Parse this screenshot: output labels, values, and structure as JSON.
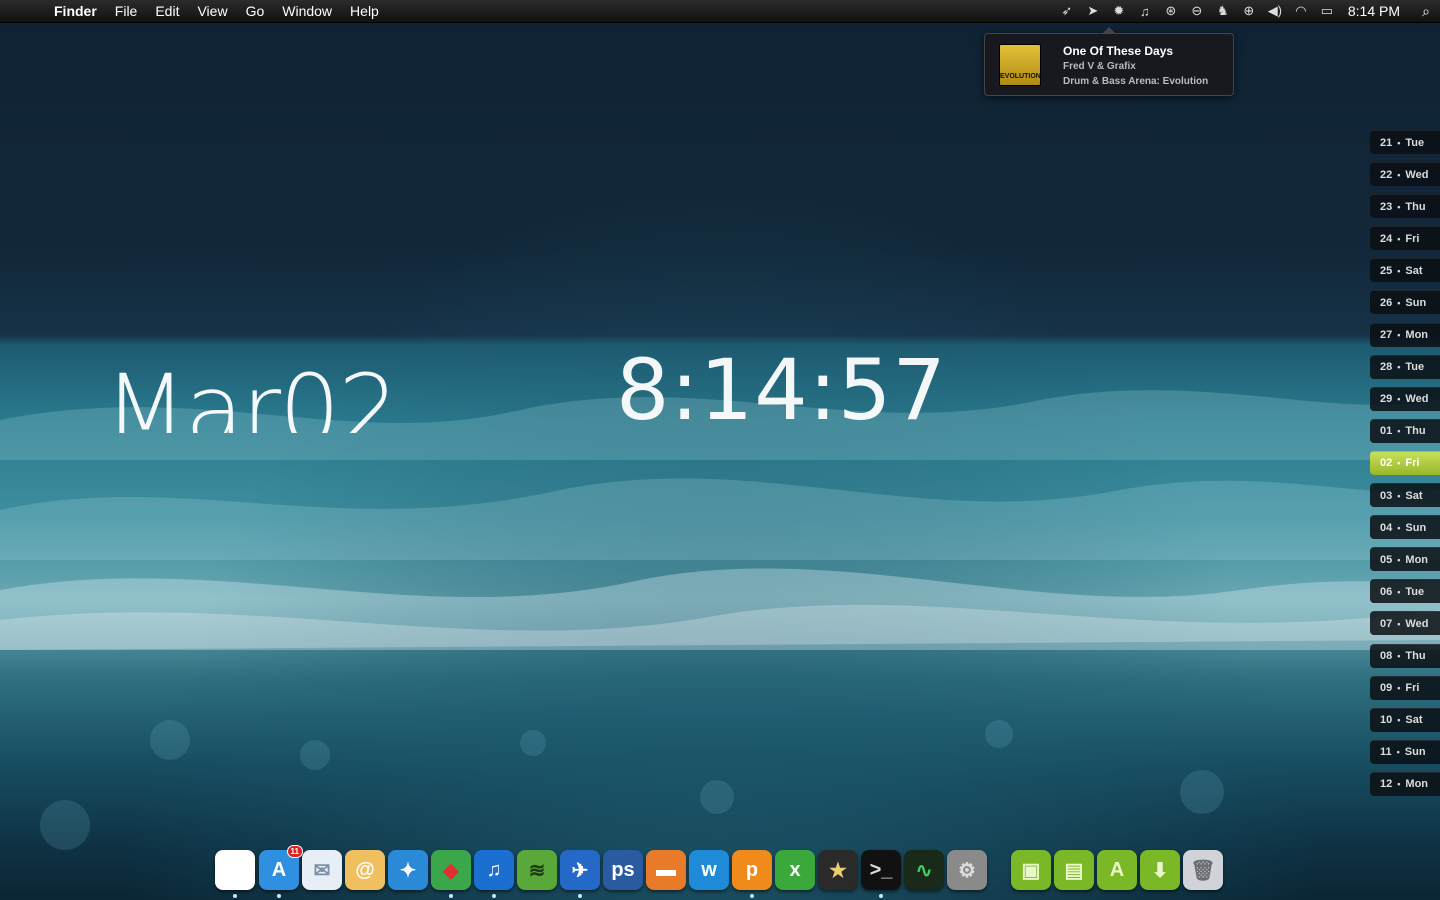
{
  "menubar": {
    "apple_glyph": "",
    "items": [
      "Finder",
      "File",
      "Edit",
      "View",
      "Go",
      "Window",
      "Help"
    ],
    "status_icons": [
      "bird-icon",
      "cursor-icon",
      "gear-icon",
      "music-note-icon",
      "timer-icon",
      "drive-icon",
      "evernote-icon",
      "settings-circle-icon",
      "volume-icon",
      "wifi-icon",
      "battery-icon"
    ],
    "clock": "8:14 PM",
    "spotlight_glyph": "⌕"
  },
  "notification": {
    "song": "One Of These Days",
    "artist": "Fred V & Grafix",
    "album": "Drum & Bass Arena: Evolution",
    "art_text": "EVOLUTION"
  },
  "widgets": {
    "date": "Mar02",
    "time": "8:14:57"
  },
  "calendar": [
    {
      "day": "21",
      "weekday": "Tue",
      "today": false
    },
    {
      "day": "22",
      "weekday": "Wed",
      "today": false
    },
    {
      "day": "23",
      "weekday": "Thu",
      "today": false
    },
    {
      "day": "24",
      "weekday": "Fri",
      "today": false
    },
    {
      "day": "25",
      "weekday": "Sat",
      "today": false
    },
    {
      "day": "26",
      "weekday": "Sun",
      "today": false
    },
    {
      "day": "27",
      "weekday": "Mon",
      "today": false
    },
    {
      "day": "28",
      "weekday": "Tue",
      "today": false
    },
    {
      "day": "29",
      "weekday": "Wed",
      "today": false
    },
    {
      "day": "01",
      "weekday": "Thu",
      "today": false
    },
    {
      "day": "02",
      "weekday": "Fri",
      "today": true
    },
    {
      "day": "03",
      "weekday": "Sat",
      "today": false
    },
    {
      "day": "04",
      "weekday": "Sun",
      "today": false
    },
    {
      "day": "05",
      "weekday": "Mon",
      "today": false
    },
    {
      "day": "06",
      "weekday": "Tue",
      "today": false
    },
    {
      "day": "07",
      "weekday": "Wed",
      "today": false
    },
    {
      "day": "08",
      "weekday": "Thu",
      "today": false
    },
    {
      "day": "09",
      "weekday": "Fri",
      "today": false
    },
    {
      "day": "10",
      "weekday": "Sat",
      "today": false
    },
    {
      "day": "11",
      "weekday": "Sun",
      "today": false
    },
    {
      "day": "12",
      "weekday": "Mon",
      "today": false
    }
  ],
  "dock": [
    {
      "name": "finder-apple-icon",
      "glyph": "",
      "bg": "#ffffff",
      "fg": "#111111",
      "running": true
    },
    {
      "name": "app-store-icon",
      "glyph": "A",
      "bg": "#2f8fe0",
      "fg": "#ffffff",
      "running": true,
      "badge": "11"
    },
    {
      "name": "mail-icon",
      "glyph": "✉",
      "bg": "#e8eef5",
      "fg": "#7a8ea8",
      "running": false
    },
    {
      "name": "address-book-icon",
      "glyph": "@",
      "bg": "#f0c060",
      "fg": "#ffffff",
      "running": false
    },
    {
      "name": "safari-icon",
      "glyph": "✦",
      "bg": "#2a8ad8",
      "fg": "#ffffff",
      "running": false
    },
    {
      "name": "maps-icon",
      "glyph": "◆",
      "bg": "#3aa84a",
      "fg": "#e03030",
      "running": true
    },
    {
      "name": "itunes-icon",
      "glyph": "♫",
      "bg": "#1a6fd0",
      "fg": "#ffffff",
      "running": true
    },
    {
      "name": "spotify-icon",
      "glyph": "≋",
      "bg": "#5aa83a",
      "fg": "#1a3a10",
      "running": false
    },
    {
      "name": "adium-icon",
      "glyph": "✈",
      "bg": "#2468c8",
      "fg": "#ffffff",
      "running": true
    },
    {
      "name": "photoshop-icon",
      "glyph": "ps",
      "bg": "#2a5aa0",
      "fg": "#ffffff",
      "running": false
    },
    {
      "name": "sparrow-icon",
      "glyph": "▬",
      "bg": "#e87a2a",
      "fg": "#ffffff",
      "running": false
    },
    {
      "name": "word-icon",
      "glyph": "w",
      "bg": "#1e8ad8",
      "fg": "#ffffff",
      "running": false
    },
    {
      "name": "pages-icon",
      "glyph": "p",
      "bg": "#f08a1a",
      "fg": "#ffffff",
      "running": true
    },
    {
      "name": "excel-icon",
      "glyph": "x",
      "bg": "#3aa83a",
      "fg": "#ffffff",
      "running": false
    },
    {
      "name": "imovie-icon",
      "glyph": "★",
      "bg": "#2a2a2a",
      "fg": "#e8d070",
      "running": false
    },
    {
      "name": "terminal-icon",
      "glyph": ">_",
      "bg": "#111111",
      "fg": "#dddddd",
      "running": true
    },
    {
      "name": "activity-monitor-icon",
      "glyph": "∿",
      "bg": "#1a2a1a",
      "fg": "#40d060",
      "running": false
    },
    {
      "name": "system-preferences-icon",
      "glyph": "⚙",
      "bg": "#8a8a8a",
      "fg": "#dddddd",
      "running": false
    },
    {
      "name": "folder-apps-icon",
      "glyph": "▣",
      "bg": "#7ab828",
      "fg": "#eaf7c8",
      "running": false
    },
    {
      "name": "folder-documents-icon",
      "glyph": "▤",
      "bg": "#7ab828",
      "fg": "#eaf7c8",
      "running": false
    },
    {
      "name": "folder-applications-icon",
      "glyph": "A",
      "bg": "#7ab828",
      "fg": "#eaf7c8",
      "running": false
    },
    {
      "name": "folder-downloads-icon",
      "glyph": "⬇",
      "bg": "#7ab828",
      "fg": "#eaf7c8",
      "running": false
    },
    {
      "name": "trash-icon",
      "glyph": "🗑",
      "bg": "#d0d4d8",
      "fg": "#6a6e72",
      "running": false
    }
  ]
}
